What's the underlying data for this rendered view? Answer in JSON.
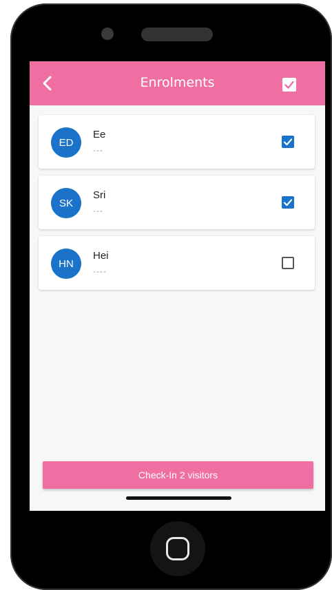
{
  "colors": {
    "accent": "#ef6fa3",
    "avatar": "#1a73c8",
    "checkbox_checked": "#1a73c8"
  },
  "header": {
    "title": "Enrolments",
    "back_icon": "chevron-left-icon",
    "select_all_icon": "checked-box-icon"
  },
  "enrolments": [
    {
      "initials": "ED",
      "name": "Ee",
      "subtitle": "---",
      "checked": true
    },
    {
      "initials": "SK",
      "name": "Sri",
      "subtitle": "---",
      "checked": true
    },
    {
      "initials": "HN",
      "name": "Hei",
      "subtitle": "----",
      "checked": false
    }
  ],
  "footer": {
    "checkin_label": "Check-In 2 visitors"
  }
}
